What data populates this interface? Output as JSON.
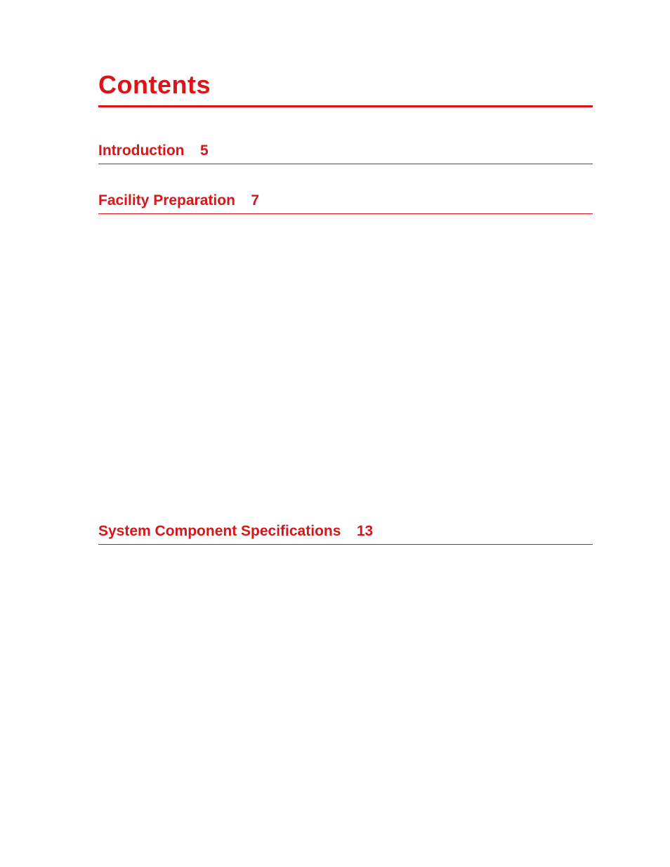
{
  "title": "Contents",
  "sections": [
    {
      "name": "Introduction",
      "page": "5"
    },
    {
      "name": "Facility Preparation",
      "page": "7"
    },
    {
      "name": "System Component Specifications",
      "page": "13"
    }
  ]
}
